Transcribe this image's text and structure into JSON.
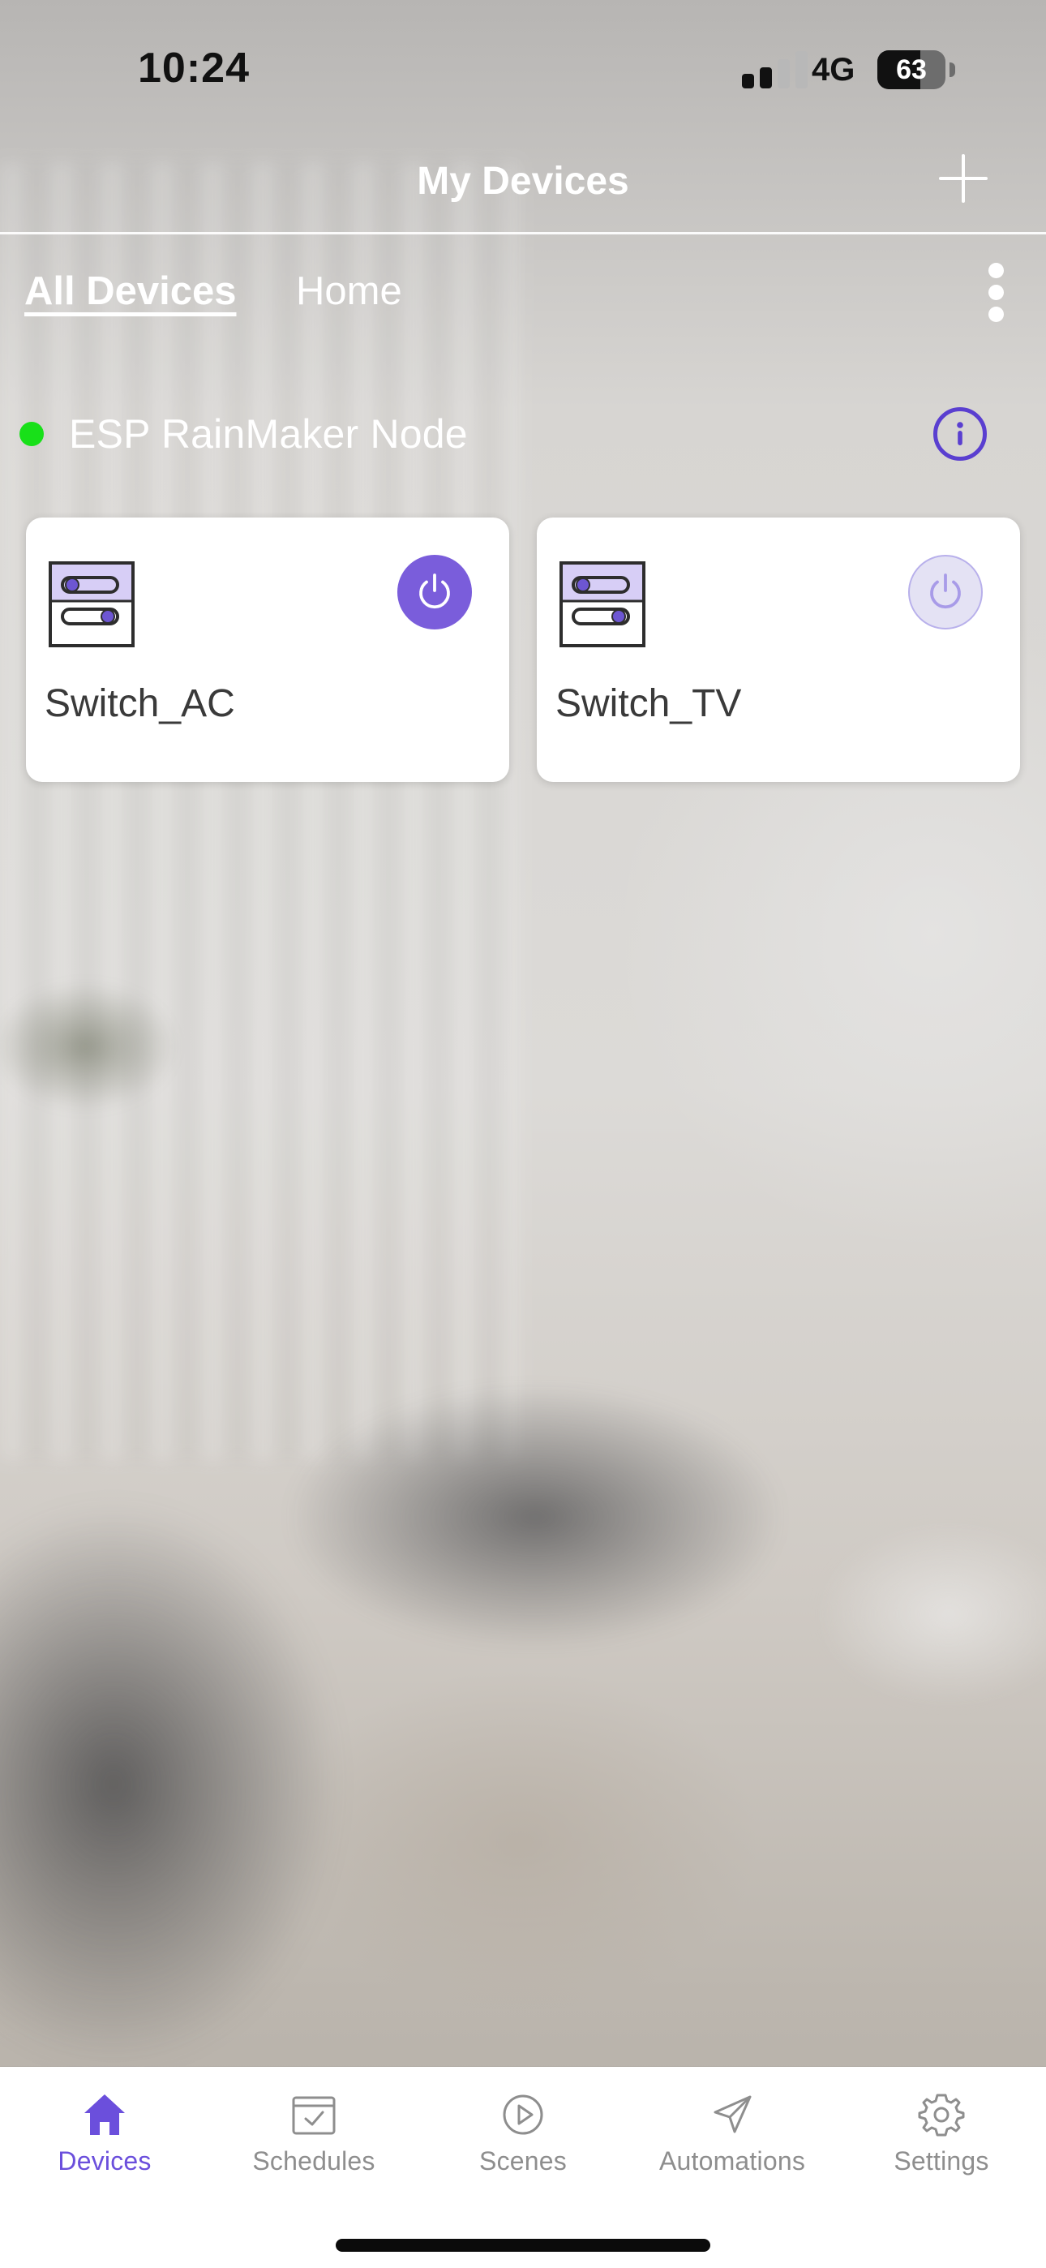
{
  "status_bar": {
    "time": "10:24",
    "network": "4G",
    "battery": "63"
  },
  "header": {
    "title": "My Devices"
  },
  "tabs": {
    "active": "All Devices",
    "inactive": "Home"
  },
  "node": {
    "name": "ESP RainMaker Node",
    "status_color": "#18e019"
  },
  "devices": [
    {
      "name": "Switch_AC",
      "power_state": "on",
      "accent": "#7a5ddb"
    },
    {
      "name": "Switch_TV",
      "power_state": "off",
      "accent": "#e4e2f4"
    }
  ],
  "tab_bar": [
    {
      "label": "Devices",
      "icon": "house-icon",
      "active": true
    },
    {
      "label": "Schedules",
      "icon": "calendar-icon",
      "active": false
    },
    {
      "label": "Scenes",
      "icon": "play-icon",
      "active": false
    },
    {
      "label": "Automations",
      "icon": "send-icon",
      "active": false
    },
    {
      "label": "Settings",
      "icon": "gear-icon",
      "active": false
    }
  ]
}
